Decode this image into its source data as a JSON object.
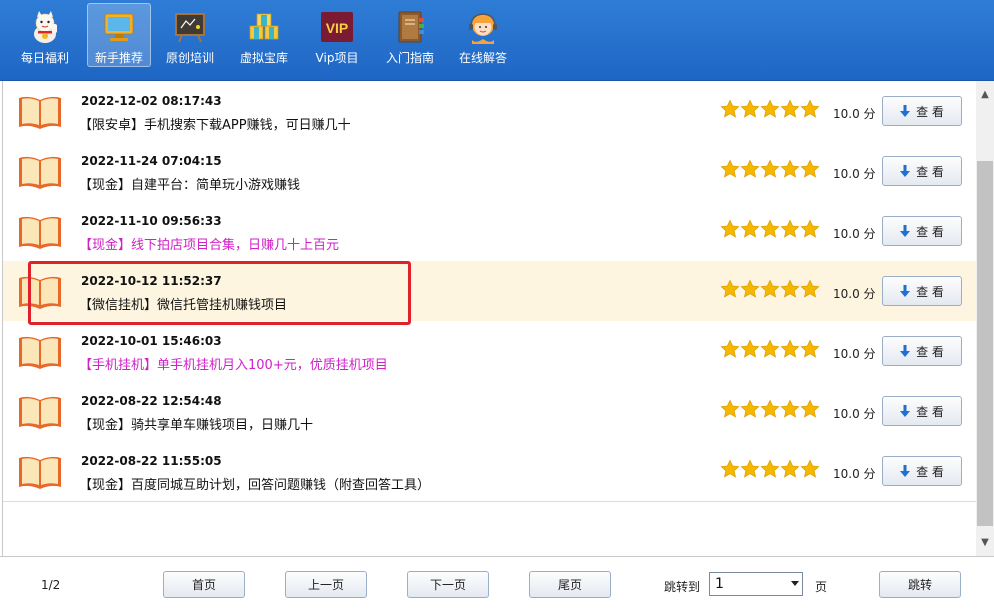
{
  "toolbar": {
    "items": [
      {
        "label": "每日福利",
        "icon": "lucky-cat-icon"
      },
      {
        "label": "新手推荐",
        "icon": "monitor-icon",
        "active": true
      },
      {
        "label": "原创培训",
        "icon": "blackboard-icon"
      },
      {
        "label": "虚拟宝库",
        "icon": "treasure-boxes-icon"
      },
      {
        "label": "Vip项目",
        "icon": "vip-badge-icon",
        "badge": "VIP"
      },
      {
        "label": "入门指南",
        "icon": "guide-book-icon"
      },
      {
        "label": "在线解答",
        "icon": "support-agent-icon"
      }
    ]
  },
  "colors": {
    "accent": "#2272cc",
    "magenta": "#d020c8",
    "star": "#f5b800",
    "highlight": "#e0202a",
    "selected_row": "#fdf5e0"
  },
  "list": {
    "rows": [
      {
        "date": "2022-12-02 08:17:43",
        "title": "【限安卓】手机搜索下载APP赚钱，可日赚几十",
        "rating": 5,
        "score": "10.0 分",
        "button": "查 看",
        "magenta": false
      },
      {
        "date": "2022-11-24 07:04:15",
        "title": "【现金】自建平台：简单玩小游戏赚钱",
        "rating": 5,
        "score": "10.0 分",
        "button": "查 看",
        "magenta": false
      },
      {
        "date": "2022-11-10 09:56:33",
        "title": "【现金】线下拍店项目合集，日赚几十上百元",
        "rating": 5,
        "score": "10.0 分",
        "button": "查 看",
        "magenta": true
      },
      {
        "date": "2022-10-12 11:52:37",
        "title": "【微信挂机】微信托管挂机赚钱项目",
        "rating": 5,
        "score": "10.0 分",
        "button": "查 看",
        "magenta": false,
        "selected": true
      },
      {
        "date": "2022-10-01 15:46:03",
        "title": "【手机挂机】单手机挂机月入100+元，优质挂机项目",
        "rating": 5,
        "score": "10.0 分",
        "button": "查 看",
        "magenta": true
      },
      {
        "date": "2022-08-22 12:54:48",
        "title": "【现金】骑共享单车赚钱项目，日赚几十",
        "rating": 5,
        "score": "10.0 分",
        "button": "查 看",
        "magenta": false
      },
      {
        "date": "2022-08-22 11:55:05",
        "title": "【现金】百度同城互助计划，回答问题赚钱（附查回答工具）",
        "rating": 5,
        "score": "10.0 分",
        "button": "查 看",
        "magenta": false
      }
    ]
  },
  "pager": {
    "page_info": "1/2",
    "first": "首页",
    "prev": "上一页",
    "next": "下一页",
    "last": "尾页",
    "jump_label": "跳转到",
    "jump_value": "1",
    "page_unit": "页",
    "jump_button": "跳转"
  }
}
